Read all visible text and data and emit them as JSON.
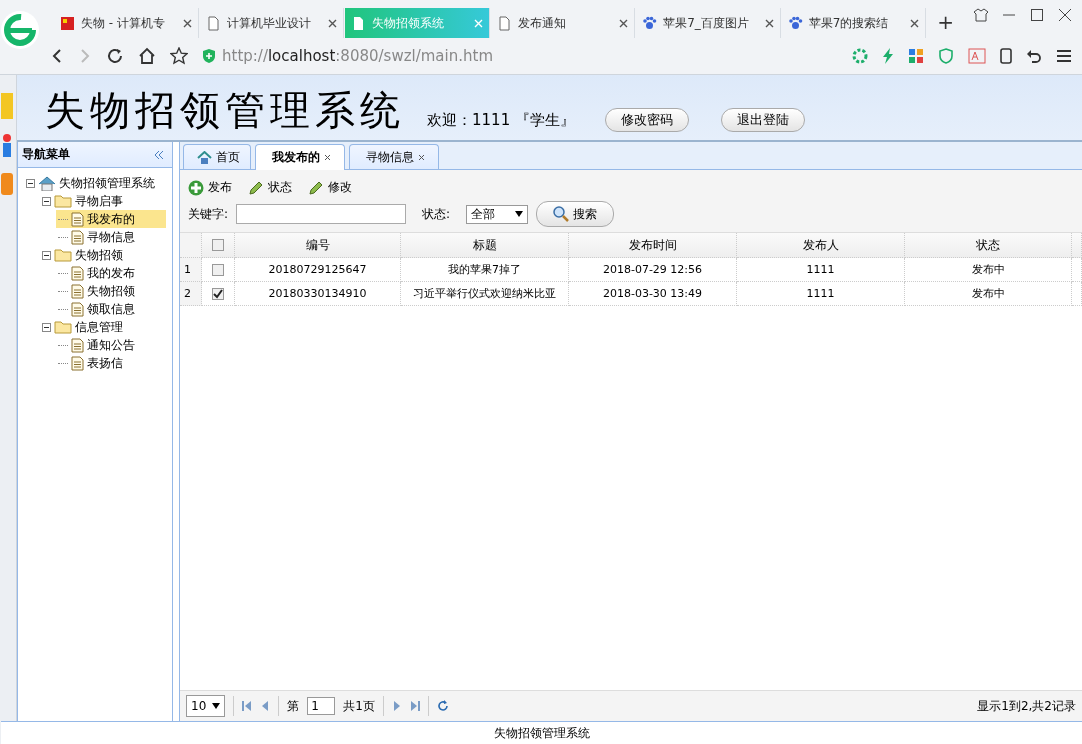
{
  "browser": {
    "tabs": [
      {
        "label": "失物 - 计算机专",
        "selected": false,
        "kind": "flag"
      },
      {
        "label": "计算机毕业设计",
        "selected": false,
        "kind": "page"
      },
      {
        "label": "失物招领系统",
        "selected": true,
        "kind": "page"
      },
      {
        "label": "发布通知",
        "selected": false,
        "kind": "page"
      },
      {
        "label": "苹果7_百度图片",
        "selected": false,
        "kind": "paw"
      },
      {
        "label": "苹果7的搜索结",
        "selected": false,
        "kind": "paw"
      }
    ],
    "new_tab": "+",
    "url": "http://**localhost**:8080/swzl/main.htm"
  },
  "header": {
    "title": "失物招领管理系统",
    "welcome": "欢迎：1111 『学生』",
    "buttons": [
      "修改密码",
      "退出登陆"
    ]
  },
  "nav": {
    "title": "导航菜单",
    "tree": [
      {
        "label": "失物招领管理系统",
        "kind": "root",
        "expanded": true,
        "children": [
          {
            "label": "寻物启事",
            "kind": "folder",
            "expanded": true,
            "children": [
              {
                "label": "我发布的",
                "kind": "leaf",
                "selected": true
              },
              {
                "label": "寻物信息",
                "kind": "leaf",
                "selected": false
              }
            ]
          },
          {
            "label": "失物招领",
            "kind": "folder",
            "expanded": true,
            "children": [
              {
                "label": "我的发布",
                "kind": "leaf",
                "selected": false
              },
              {
                "label": "失物招领",
                "kind": "leaf",
                "selected": false
              },
              {
                "label": "领取信息",
                "kind": "leaf",
                "selected": false
              }
            ]
          },
          {
            "label": "信息管理",
            "kind": "folder",
            "expanded": true,
            "children": [
              {
                "label": "通知公告",
                "kind": "leaf",
                "selected": false
              },
              {
                "label": "表扬信",
                "kind": "leaf",
                "selected": false
              }
            ]
          }
        ]
      }
    ]
  },
  "main": {
    "tabs": [
      {
        "label": "首页",
        "selected": false,
        "closable": false
      },
      {
        "label": "我发布的",
        "selected": true,
        "closable": true
      },
      {
        "label": "寻物信息",
        "selected": false,
        "closable": true
      }
    ],
    "toolbar": [
      {
        "label": "发布",
        "kind": "add"
      },
      {
        "label": "状态",
        "kind": "edit"
      },
      {
        "label": "修改",
        "kind": "edit"
      }
    ],
    "search": {
      "keyword_label": "关键字:",
      "status_label": "状态:",
      "status_value": "全部",
      "button": "搜索"
    },
    "grid": {
      "header_checked": false,
      "columns": [
        "编号",
        "标题",
        "发布时间",
        "发布人",
        "状态"
      ],
      "rows": [
        {
          "index": "1",
          "checked": false,
          "cells": [
            "20180729125647",
            "我的苹果7掉了",
            "2018-07-29 12:56",
            "1111",
            "发布中"
          ]
        },
        {
          "index": "2",
          "checked": true,
          "cells": [
            "20180330134910",
            "习近平举行仪式欢迎纳米比亚",
            "2018-03-30 13:49",
            "1111",
            "发布中"
          ]
        }
      ]
    },
    "pager": {
      "page_size": "10",
      "before": "第",
      "page": "1",
      "after": "共1页",
      "info": "显示1到2,共2记录"
    }
  },
  "footer": "失物招领管理系统"
}
